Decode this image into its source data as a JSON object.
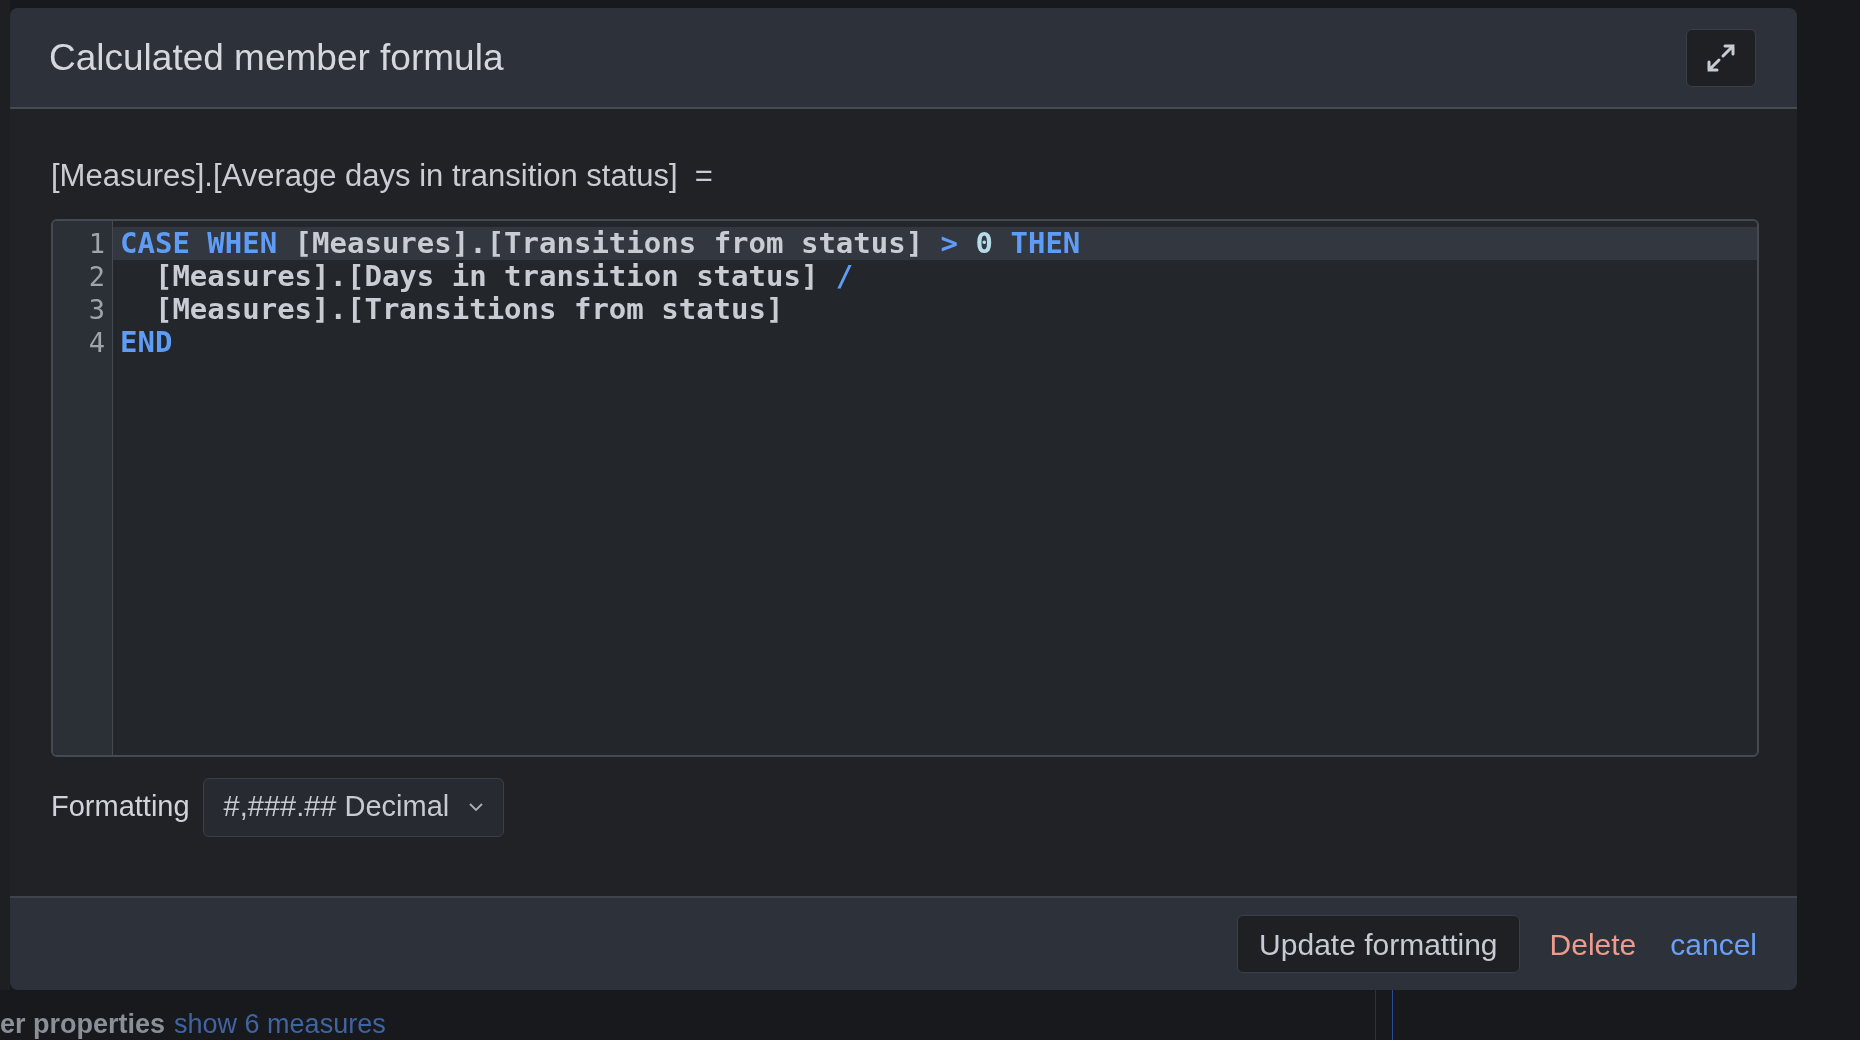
{
  "dialog": {
    "title": "Calculated member formula",
    "member_label": "[Measures].[Average days in transition status]  =",
    "editor": {
      "lines": [
        {
          "number": "1",
          "active": true,
          "tokens": [
            {
              "text": "CASE WHEN",
              "kind": "keyword"
            },
            {
              "text": " [Measures].[Transitions from status] ",
              "kind": "ident"
            },
            {
              "text": ">",
              "kind": "operator"
            },
            {
              "text": " 0",
              "kind": "number"
            },
            {
              "text": " THEN",
              "kind": "keyword"
            }
          ]
        },
        {
          "number": "2",
          "active": false,
          "tokens": [
            {
              "text": "  [Measures].[Days in transition status] ",
              "kind": "ident"
            },
            {
              "text": "/",
              "kind": "operator"
            }
          ]
        },
        {
          "number": "3",
          "active": false,
          "tokens": [
            {
              "text": "  [Measures].[Transitions from status]",
              "kind": "ident"
            }
          ]
        },
        {
          "number": "4",
          "active": false,
          "tokens": [
            {
              "text": "END",
              "kind": "keyword"
            }
          ]
        }
      ]
    },
    "formatting": {
      "label": "Formatting",
      "value": "#,###.## Decimal"
    },
    "buttons": [
      {
        "label": "Update formatting",
        "kind": "primary"
      },
      {
        "label": "Delete",
        "kind": "danger"
      },
      {
        "label": "cancel",
        "kind": "link"
      }
    ]
  },
  "background": {
    "property_label": "er properties",
    "link": "show 6 measures"
  }
}
